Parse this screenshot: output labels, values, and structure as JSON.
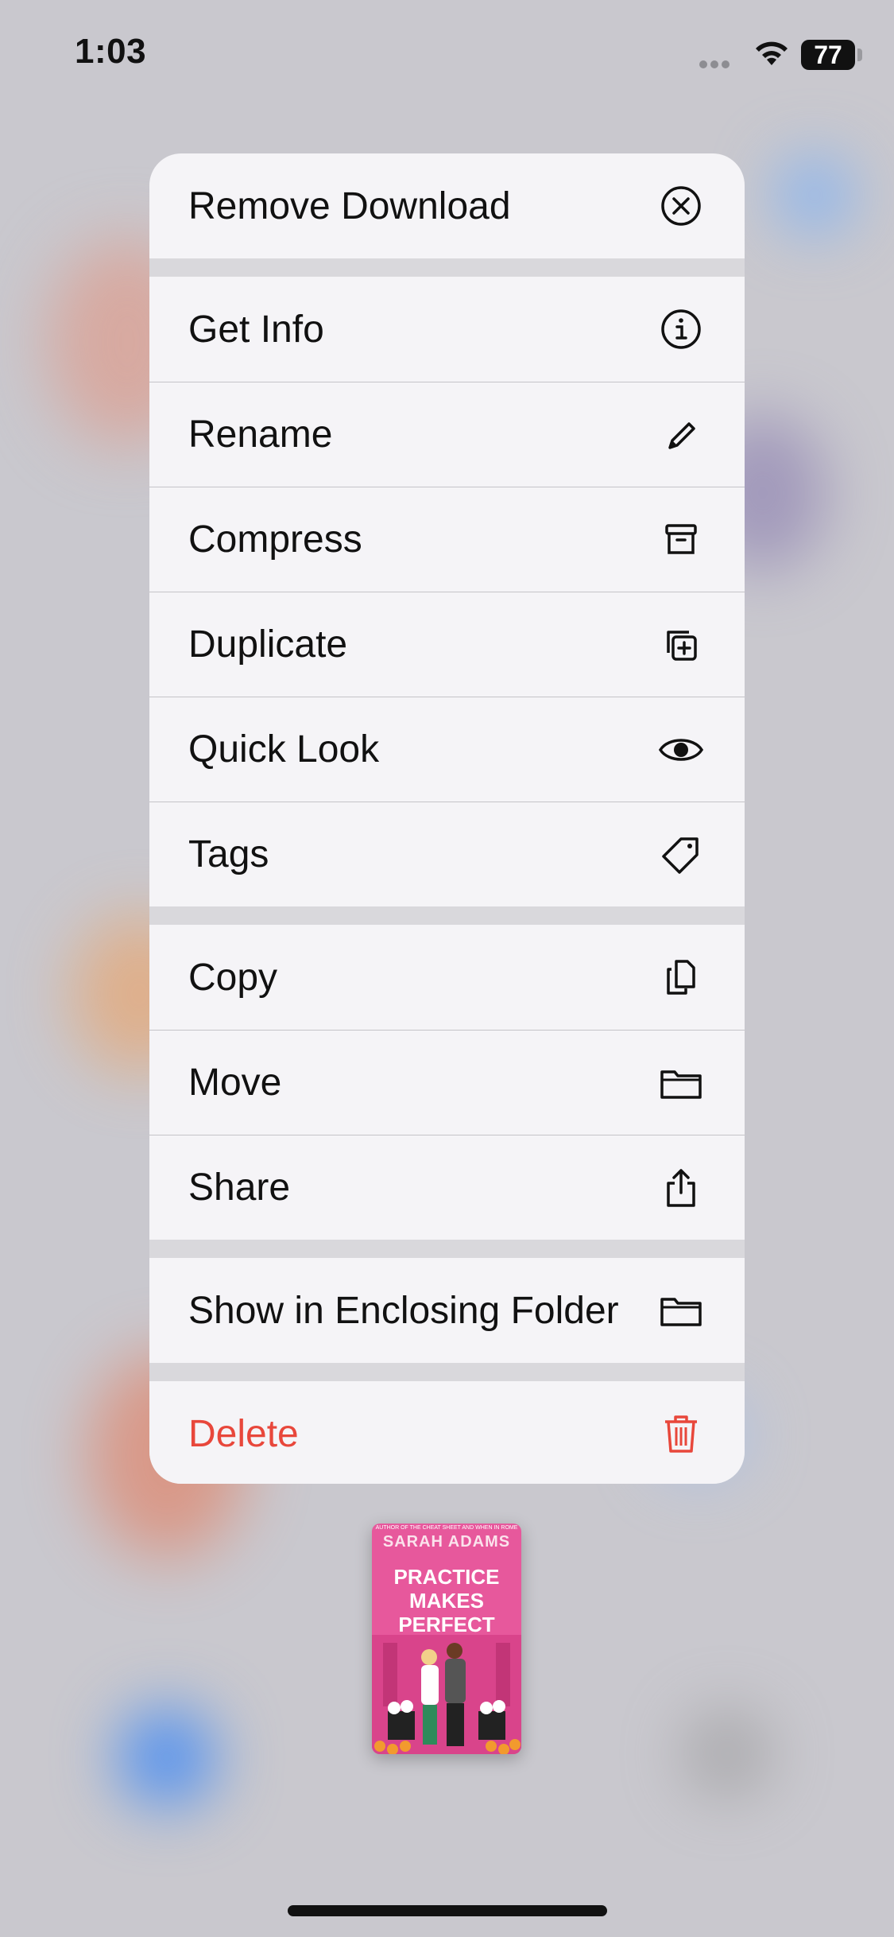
{
  "status_bar": {
    "time": "1:03",
    "battery": "77"
  },
  "menu": {
    "groups": [
      {
        "items": [
          {
            "label": "Remove Download",
            "icon": "xmark-circle-icon"
          }
        ]
      },
      {
        "items": [
          {
            "label": "Get Info",
            "icon": "info-circle-icon"
          },
          {
            "label": "Rename",
            "icon": "pencil-icon"
          },
          {
            "label": "Compress",
            "icon": "archive-box-icon"
          },
          {
            "label": "Duplicate",
            "icon": "plus-square-on-square-icon"
          },
          {
            "label": "Quick Look",
            "icon": "eye-icon"
          },
          {
            "label": "Tags",
            "icon": "tag-icon"
          }
        ]
      },
      {
        "items": [
          {
            "label": "Copy",
            "icon": "doc-on-doc-icon"
          },
          {
            "label": "Move",
            "icon": "folder-icon"
          },
          {
            "label": "Share",
            "icon": "share-icon"
          }
        ]
      },
      {
        "items": [
          {
            "label": "Show in Enclosing Folder",
            "icon": "folder-icon"
          }
        ]
      },
      {
        "items": [
          {
            "label": "Delete",
            "icon": "trash-icon",
            "destructive": true
          }
        ]
      }
    ],
    "colors": {
      "destructive": "#e8473b",
      "text": "#111111"
    }
  },
  "preview": {
    "author": "SARAH ADAMS",
    "title_lines": [
      "PRACTICE",
      "MAKES",
      "PERFECT"
    ],
    "cover_color": "#e7589c"
  }
}
